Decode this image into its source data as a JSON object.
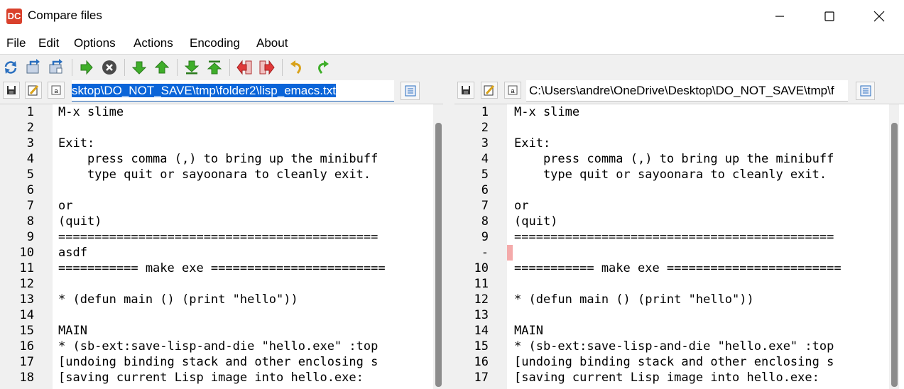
{
  "window": {
    "title": "Compare files",
    "icon": "diff-app-icon",
    "icon_text": "DC"
  },
  "menu": [
    "File",
    "Edit",
    "Options",
    "Actions",
    "Encoding",
    "About"
  ],
  "toolbar": {
    "buttons": [
      "refresh-icon",
      "open-left-icon",
      "open-right-icon",
      "next-arrow-icon",
      "stop-icon",
      "next-diff-icon",
      "prev-diff-icon",
      "last-diff-icon",
      "first-diff-icon",
      "copy-left-icon",
      "copy-right-icon",
      "undo-icon",
      "redo-icon"
    ]
  },
  "left": {
    "path": "sktop\\DO_NOT_SAVE\\tmp\\folder2\\lisp_emacs.txt",
    "lines": [
      {
        "n": "1",
        "t": "M-x slime"
      },
      {
        "n": "2",
        "t": ""
      },
      {
        "n": "3",
        "t": "Exit:"
      },
      {
        "n": "4",
        "t": "    press comma (,) to bring up the minibuff"
      },
      {
        "n": "5",
        "t": "    type quit or sayoonara to cleanly exit."
      },
      {
        "n": "6",
        "t": ""
      },
      {
        "n": "7",
        "t": "or"
      },
      {
        "n": "8",
        "t": "(quit)"
      },
      {
        "n": "9",
        "t": "============================================"
      },
      {
        "n": "10",
        "t": "asdf",
        "diff": true
      },
      {
        "n": "11",
        "t": "=========== make exe ========================"
      },
      {
        "n": "12",
        "t": ""
      },
      {
        "n": "13",
        "t": "* (defun main () (print \"hello\"))"
      },
      {
        "n": "14",
        "t": ""
      },
      {
        "n": "15",
        "t": "MAIN"
      },
      {
        "n": "16",
        "t": "* (sb-ext:save-lisp-and-die \"hello.exe\" :top"
      },
      {
        "n": "17",
        "t": "[undoing binding stack and other enclosing s"
      },
      {
        "n": "18",
        "t": "[saving current Lisp image into hello.exe:"
      }
    ]
  },
  "right": {
    "path": "C:\\Users\\andre\\OneDrive\\Desktop\\DO_NOT_SAVE\\tmp\\f",
    "lines": [
      {
        "n": "1",
        "t": "M-x slime"
      },
      {
        "n": "2",
        "t": ""
      },
      {
        "n": "3",
        "t": "Exit:"
      },
      {
        "n": "4",
        "t": "    press comma (,) to bring up the minibuff"
      },
      {
        "n": "5",
        "t": "    type quit or sayoonara to cleanly exit."
      },
      {
        "n": "6",
        "t": ""
      },
      {
        "n": "7",
        "t": "or"
      },
      {
        "n": "8",
        "t": "(quit)"
      },
      {
        "n": "9",
        "t": "============================================"
      },
      {
        "n": "-",
        "t": "",
        "diff": true
      },
      {
        "n": "10",
        "t": "=========== make exe ========================"
      },
      {
        "n": "11",
        "t": ""
      },
      {
        "n": "12",
        "t": "* (defun main () (print \"hello\"))"
      },
      {
        "n": "13",
        "t": ""
      },
      {
        "n": "14",
        "t": "MAIN"
      },
      {
        "n": "15",
        "t": "* (sb-ext:save-lisp-and-die \"hello.exe\" :top"
      },
      {
        "n": "16",
        "t": "[undoing binding stack and other enclosing s"
      },
      {
        "n": "17",
        "t": "[saving current Lisp image into hello.exe:"
      }
    ]
  },
  "colors": {
    "diff": "#f4aaaa",
    "selection": "#0a64d8",
    "gutter": "#f0f0f0"
  }
}
